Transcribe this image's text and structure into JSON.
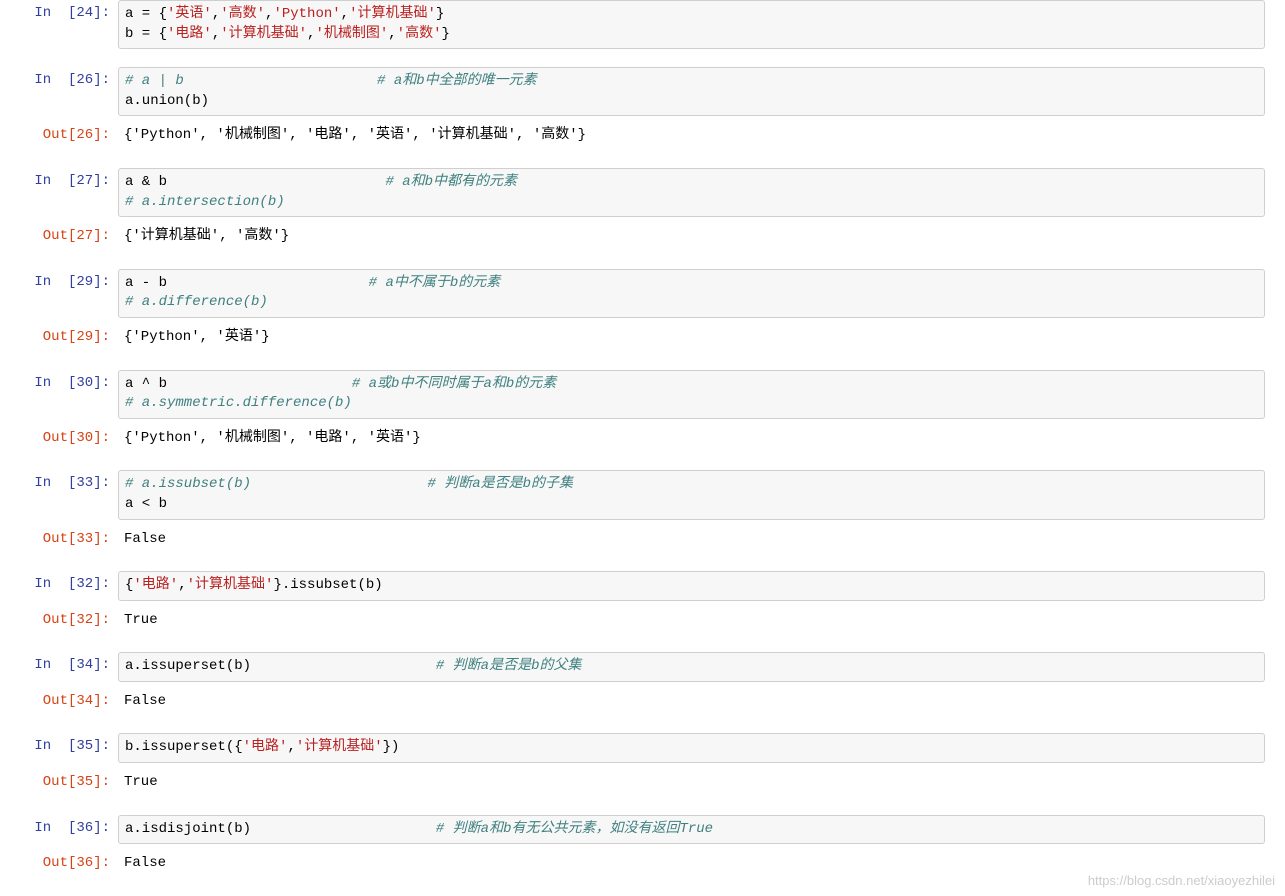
{
  "watermark": "https://blog.csdn.net/xiaoyezhilei",
  "cells": [
    {
      "in_num": "24",
      "code_html": "a = {<span class='s'>'英语'</span>,<span class='s'>'高数'</span>,<span class='s'>'Python'</span>,<span class='s'>'计算机基础'</span>}\nb = {<span class='s'>'电路'</span>,<span class='s'>'计算机基础'</span>,<span class='s'>'机械制图'</span>,<span class='s'>'高数'</span>}",
      "has_output": false
    },
    {
      "in_num": "26",
      "code_html": "<span class='c'># a | b                       # a和b中全部的唯一元素</span>\na.union(b)",
      "out_num": "26",
      "output": "{'Python', '机械制图', '电路', '英语', '计算机基础', '高数'}",
      "has_output": true
    },
    {
      "in_num": "27",
      "code_html": "a &amp; b                          <span class='c'># a和b中都有的元素</span>\n<span class='c'># a.intersection(b)</span>",
      "out_num": "27",
      "output": "{'计算机基础', '高数'}",
      "has_output": true
    },
    {
      "in_num": "29",
      "code_html": "a - b                        <span class='c'># a中不属于b的元素</span>\n<span class='c'># a.difference(b)</span>",
      "out_num": "29",
      "output": "{'Python', '英语'}",
      "has_output": true
    },
    {
      "in_num": "30",
      "code_html": "a ^ b                      <span class='c'># a或b中不同时属于a和b的元素</span>\n<span class='c'># a.symmetric.difference(b)</span>",
      "out_num": "30",
      "output": "{'Python', '机械制图', '电路', '英语'}",
      "has_output": true
    },
    {
      "in_num": "33",
      "code_html": "<span class='c'># a.issubset(b)                     # 判断a是否是b的子集</span>\na &lt; b",
      "out_num": "33",
      "output": "False",
      "has_output": true
    },
    {
      "in_num": "32",
      "code_html": "{<span class='s'>'电路'</span>,<span class='s'>'计算机基础'</span>}.issubset(b)",
      "out_num": "32",
      "output": "True",
      "has_output": true
    },
    {
      "in_num": "34",
      "code_html": "a.issuperset(b)                      <span class='c'># 判断a是否是b的父集</span>",
      "out_num": "34",
      "output": "False",
      "has_output": true
    },
    {
      "in_num": "35",
      "code_html": "b.issuperset({<span class='s'>'电路'</span>,<span class='s'>'计算机基础'</span>})",
      "out_num": "35",
      "output": "True",
      "has_output": true
    },
    {
      "in_num": "36",
      "code_html": "a.isdisjoint(b)                      <span class='c'># 判断a和b有无公共元素，如没有返回True</span>",
      "out_num": "36",
      "output": "False",
      "has_output": true
    }
  ]
}
